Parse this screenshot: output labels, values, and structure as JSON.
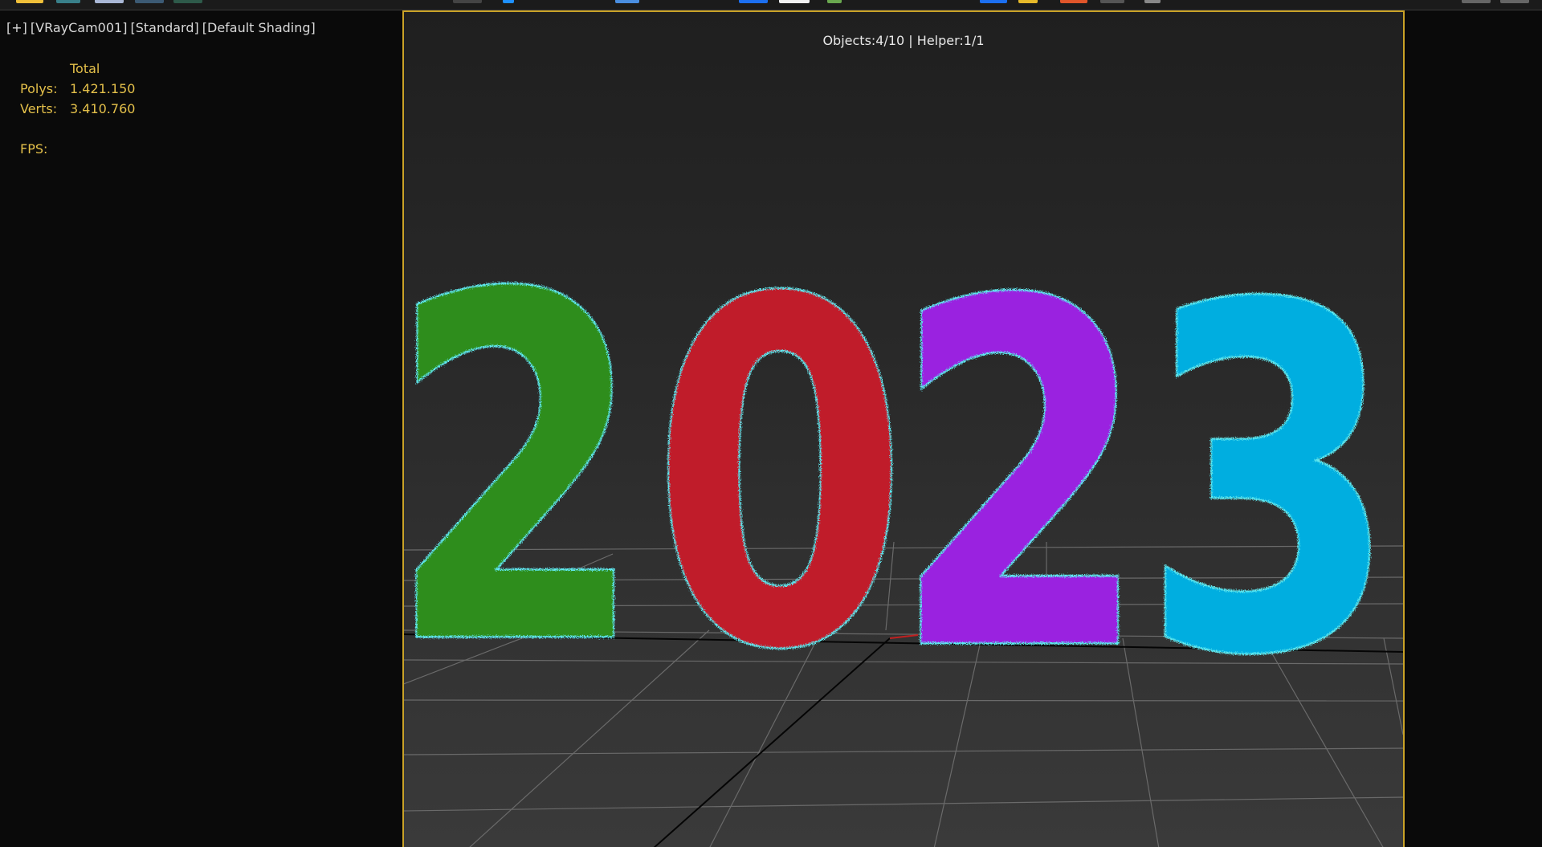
{
  "viewport_label": {
    "menu": "[+]",
    "camera": "[VRayCam001]",
    "mode": "[Standard]",
    "shading": "[Default Shading]"
  },
  "stats": {
    "header": "Total",
    "polys_label": "Polys:",
    "polys_value": "1.421.150",
    "verts_label": "Verts:",
    "verts_value": "3.410.760",
    "fps_label": "FPS:",
    "fps_value": ""
  },
  "viewport": {
    "selection_info": "Objects:4/10 | Helper:1/1"
  },
  "scene": {
    "digits": [
      {
        "char": "2",
        "color": "#2f8d1f"
      },
      {
        "char": "0",
        "color": "#c01a2b"
      },
      {
        "char": "2",
        "color": "#9a20e0"
      },
      {
        "char": "3",
        "color": "#00aee0"
      }
    ],
    "selection_outline_color": "#5fe8ef"
  },
  "colors": {
    "viewport_border": "#c9a227",
    "stats_text": "#e4c04a",
    "label_text": "#d9d9d9"
  }
}
